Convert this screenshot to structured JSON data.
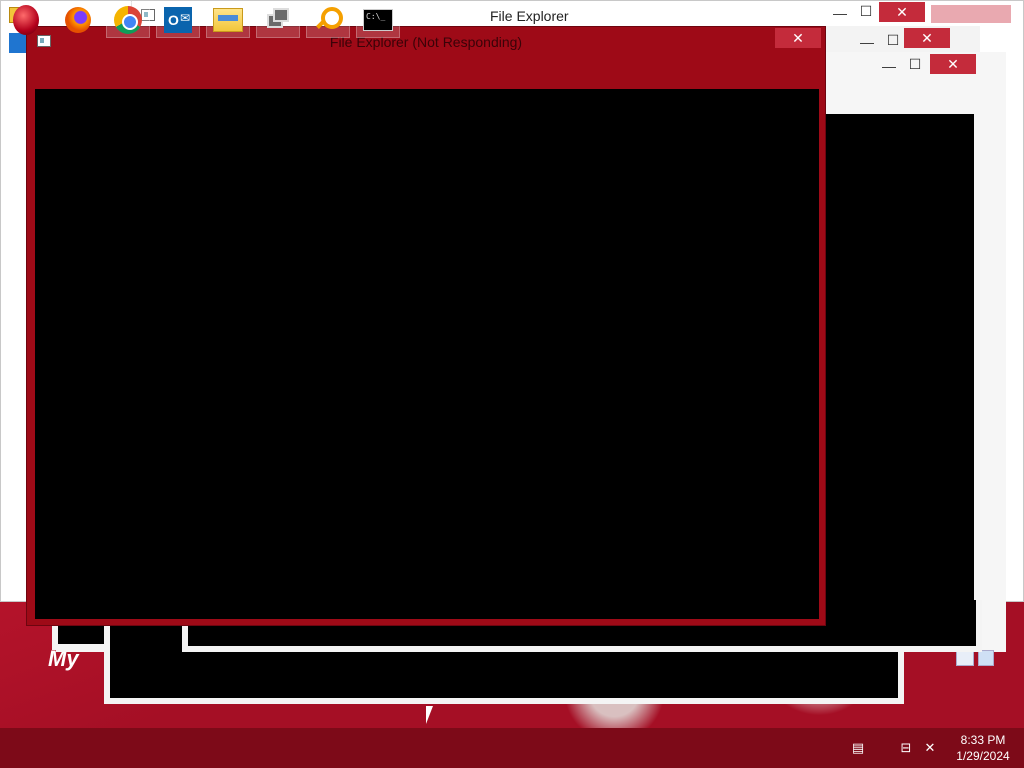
{
  "desktop": {
    "wallpaper_text": "My"
  },
  "windows": {
    "background_main": {
      "title": "File Explorer",
      "minimize": "—",
      "maximize": "☐",
      "close": "✕"
    },
    "background_second": {
      "minimize": "—",
      "maximize": "☐",
      "close": "✕"
    },
    "background_third": {
      "minimize": "—",
      "maximize": "☐",
      "close": "✕"
    },
    "not_responding": {
      "title": "File Explorer (Not Responding)",
      "close": "✕"
    }
  },
  "taskbar": {
    "items": [
      {
        "name": "start-button",
        "icon": "start-orb-icon"
      },
      {
        "name": "firefox",
        "icon": "firefox-icon"
      },
      {
        "name": "chrome",
        "icon": "chrome-icon"
      },
      {
        "name": "outlook",
        "icon": "outlook-icon",
        "label": "O"
      },
      {
        "name": "file-explorer",
        "icon": "folder-icon"
      },
      {
        "name": "task-switcher",
        "icon": "window-switch-icon"
      },
      {
        "name": "search",
        "icon": "search-icon"
      },
      {
        "name": "command-prompt",
        "icon": "cmd-icon",
        "label": "C:\\_"
      }
    ],
    "clock": {
      "time": "8:33 PM",
      "date": "1/29/2024"
    }
  },
  "colors": {
    "accent": "#9e0a17",
    "taskbar": "#7d0a18",
    "close": "#c42b3b"
  }
}
